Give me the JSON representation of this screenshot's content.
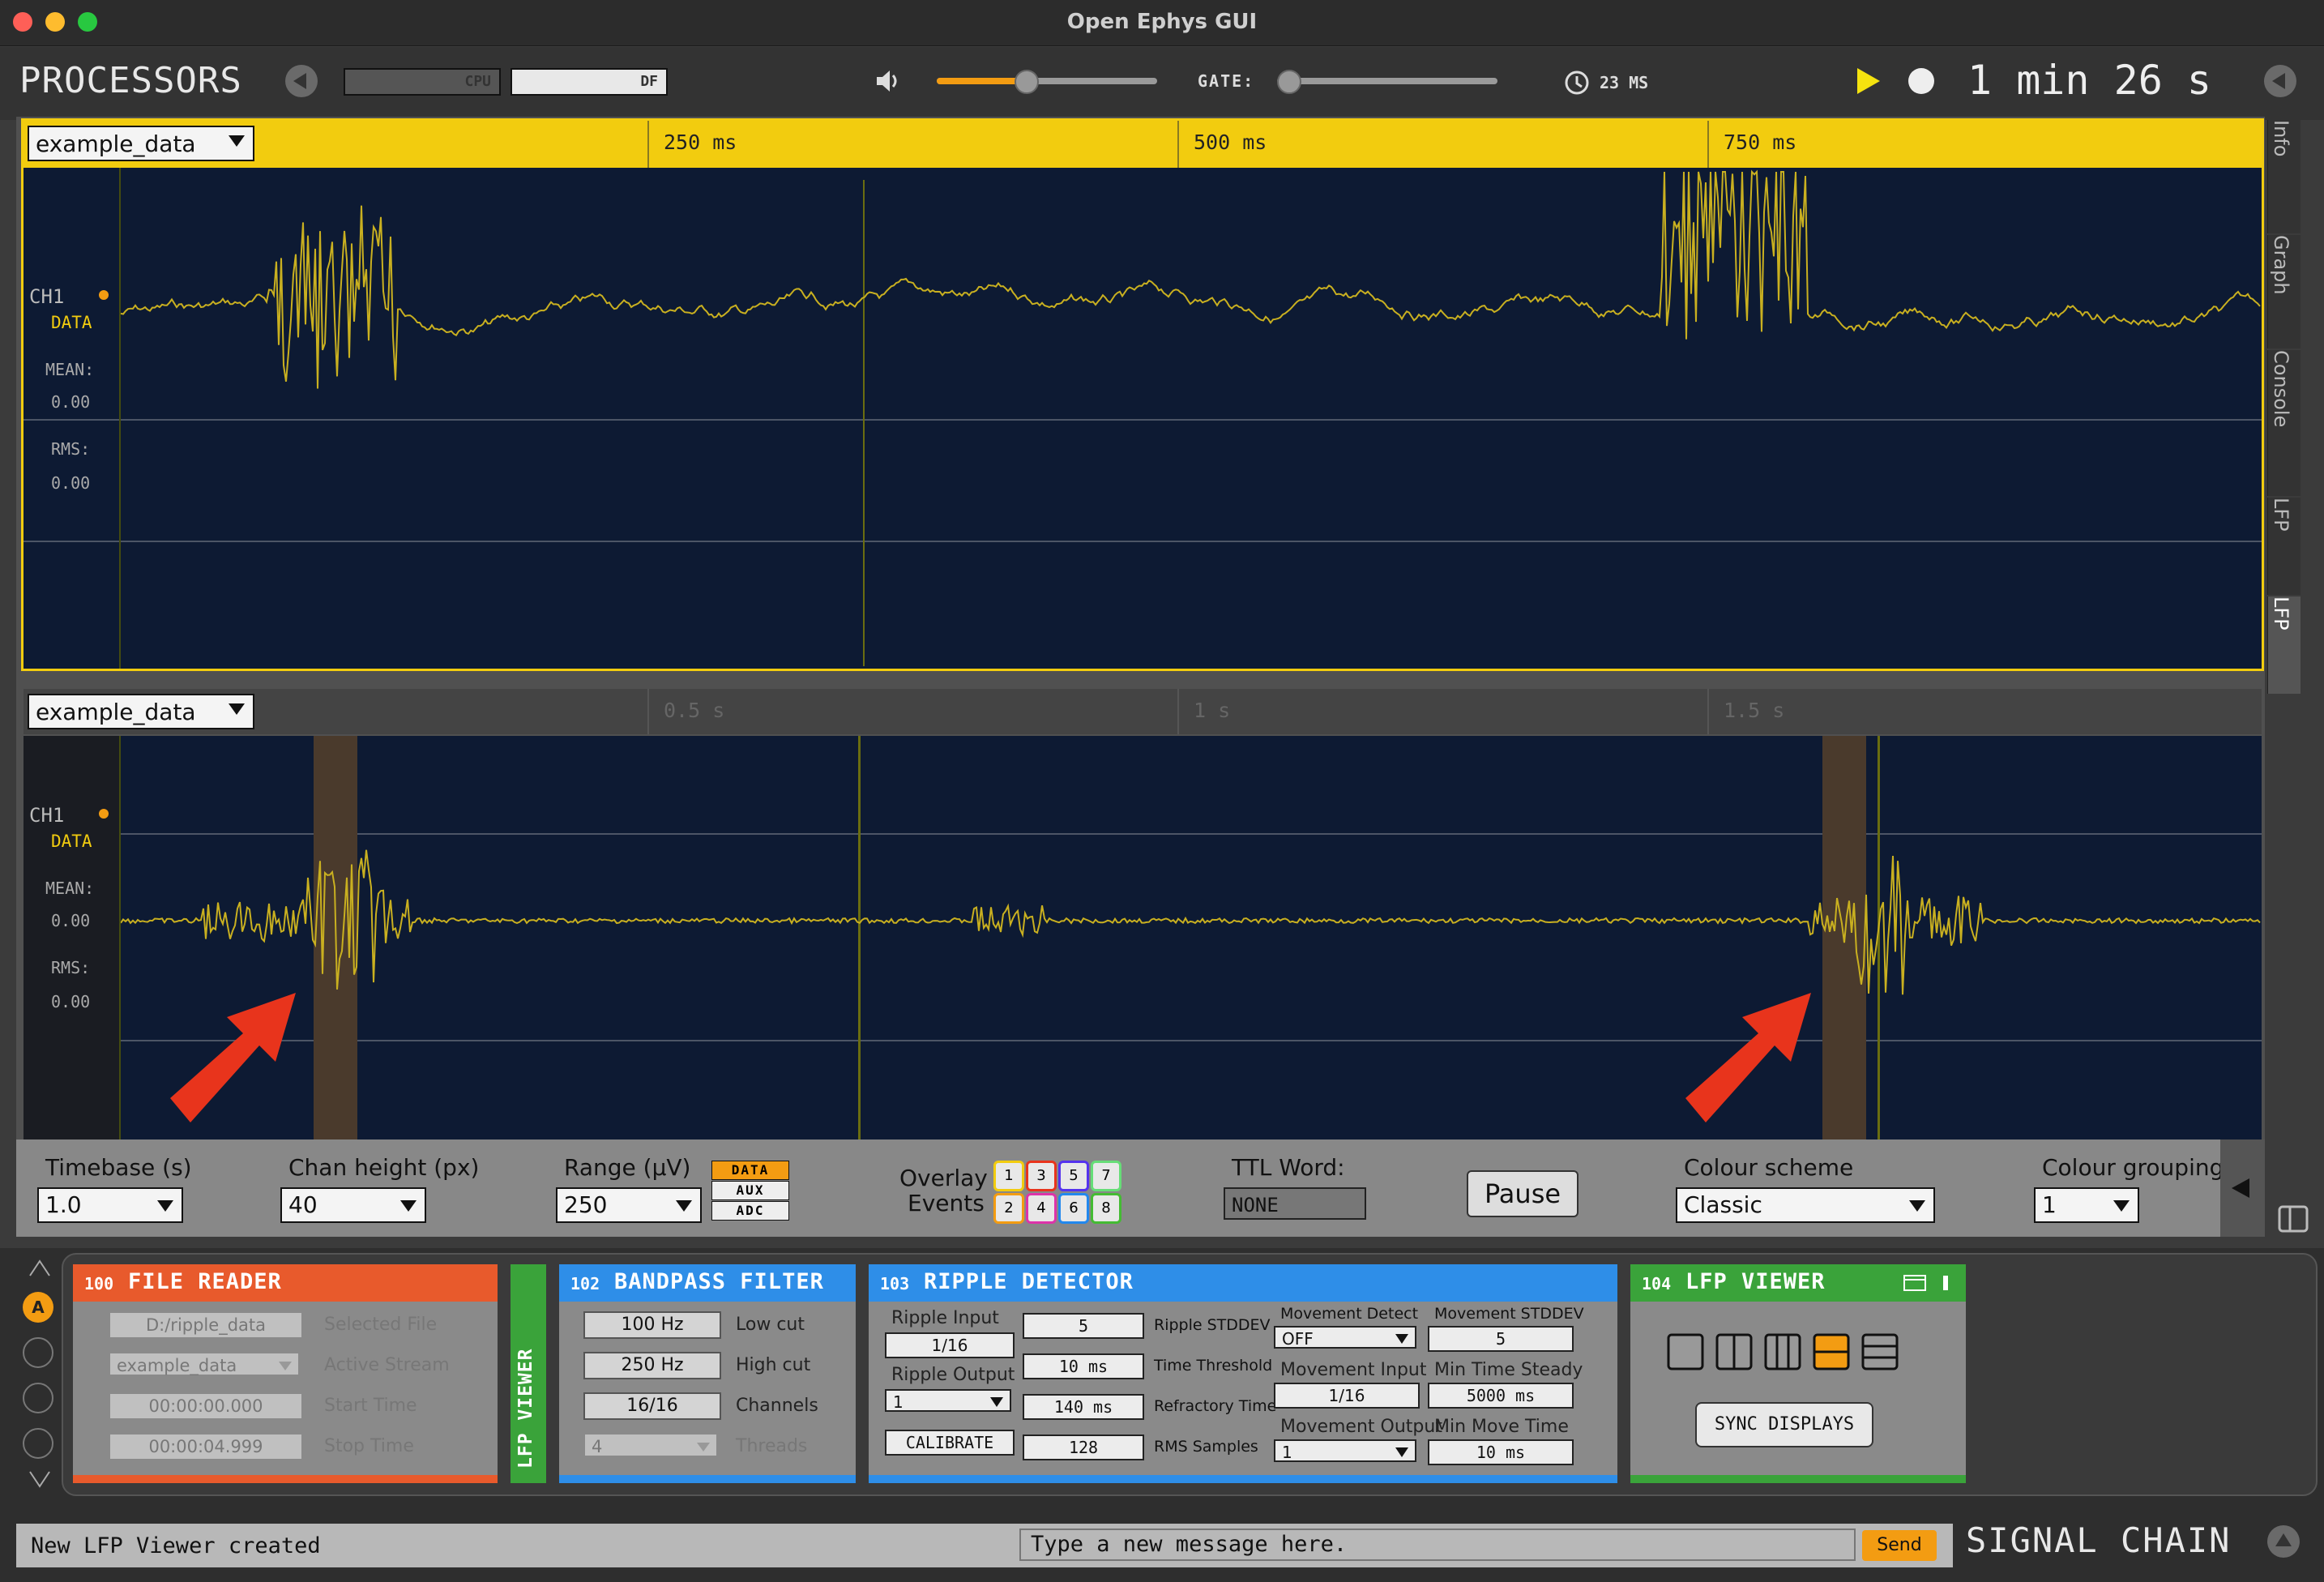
{
  "window": {
    "title": "Open Ephys GUI"
  },
  "control_bar": {
    "processors_label": "PROCESSORS",
    "cpu_label": "CPU",
    "df_label": "DF",
    "gate_label": "GATE:",
    "latency": "23 MS",
    "clock": "1 min 26 s",
    "volume_level": 0.4,
    "gate_level": 0.0,
    "colors": {
      "accent": "#f39c12",
      "play": "#f5e30f"
    }
  },
  "side_tabs": [
    "Info",
    "Graph",
    "Console",
    "LFP",
    "LFP"
  ],
  "display1": {
    "stream": "example_data",
    "ticks": [
      "250 ms",
      "500 ms",
      "750 ms"
    ],
    "channel": {
      "name": "CH1",
      "type": "DATA",
      "mean_label": "MEAN:",
      "mean_value": "0.00",
      "rms_label": "RMS:",
      "rms_value": "0.00"
    }
  },
  "display2": {
    "stream": "example_data",
    "ticks": [
      "0.5 s",
      "1 s",
      "1.5 s"
    ],
    "channel": {
      "name": "CH1",
      "type": "DATA",
      "mean_label": "MEAN:",
      "mean_value": "0.00",
      "rms_label": "RMS:",
      "rms_value": "0.00"
    }
  },
  "options": {
    "timebase_label": "Timebase (s)",
    "timebase_value": "1.0",
    "chan_height_label": "Chan height (px)",
    "chan_height_value": "40",
    "range_label": "Range (µV)",
    "range_value": "250",
    "range_types": [
      "DATA",
      "AUX",
      "ADC"
    ],
    "overlay_label_1": "Overlay",
    "overlay_label_2": "Events",
    "event_buttons": [
      "1",
      "3",
      "5",
      "7",
      "2",
      "4",
      "6",
      "8"
    ],
    "ttl_label": "TTL Word:",
    "ttl_value": "NONE",
    "pause_label": "Pause",
    "colour_scheme_label": "Colour scheme",
    "colour_scheme_value": "Classic",
    "colour_grouping_label": "Colour grouping",
    "colour_grouping_value": "1"
  },
  "signal_chain_buttons": {
    "a_label": "A"
  },
  "editors": {
    "file_reader": {
      "num": "100",
      "title": "FILE READER",
      "fields": [
        {
          "value": "D:/ripple_data",
          "label": "Selected File"
        },
        {
          "value": "example_data",
          "label": "Active Stream"
        },
        {
          "value": "00:00:00.000",
          "label": "Start Time"
        },
        {
          "value": "00:00:04.999",
          "label": "Stop Time"
        }
      ]
    },
    "lfp_viewer_collapsed": {
      "title": "LFP VIEWER"
    },
    "bandpass": {
      "num": "102",
      "title": "BANDPASS FILTER",
      "fields": [
        {
          "value": "100 Hz",
          "label": "Low cut"
        },
        {
          "value": "250 Hz",
          "label": "High cut"
        },
        {
          "value": "16/16",
          "label": "Channels"
        },
        {
          "value": "4",
          "label": "Threads"
        }
      ]
    },
    "ripple": {
      "num": "103",
      "title": "RIPPLE DETECTOR",
      "ripple_input_label": "Ripple Input",
      "ripple_input_value": "1/16",
      "ripple_output_label": "Ripple Output",
      "ripple_output_value": "1",
      "calibrate_label": "CALIBRATE",
      "mid": [
        {
          "value": "5",
          "label": "Ripple STDDEV"
        },
        {
          "value": "10 ms",
          "label": "Time Threshold"
        },
        {
          "value": "140 ms",
          "label": "Refractory Time"
        },
        {
          "value": "128",
          "label": "RMS Samples"
        }
      ],
      "movement_detect_label": "Movement Detect",
      "movement_detect_value": "OFF",
      "movement_stddev_label": "Movement STDDEV",
      "movement_stddev_value": "5",
      "movement_input_label": "Movement Input",
      "movement_input_value": "1/16",
      "min_time_steady_label": "Min Time Steady",
      "min_time_steady_value": "5000 ms",
      "movement_output_label": "Movement Output",
      "movement_output_value": "1",
      "min_move_time_label": "Min Move Time",
      "min_move_time_value": "10 ms"
    },
    "lfp_viewer": {
      "num": "104",
      "title": "LFP VIEWER",
      "sync_label": "SYNC DISPLAYS"
    }
  },
  "status_bar": {
    "message": "New LFP Viewer created",
    "input_placeholder": "Type a new message here.",
    "send_label": "Send",
    "signal_chain_label": "SIGNAL CHAIN"
  }
}
